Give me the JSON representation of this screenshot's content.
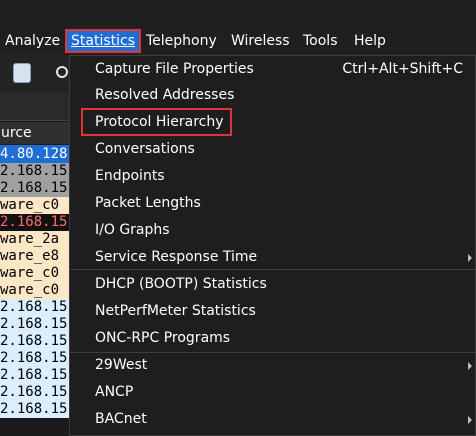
{
  "menubar": {
    "items": [
      "Analyze",
      "Statistics",
      "Telephony",
      "Wireless",
      "Tools",
      "Help"
    ]
  },
  "packet_list": {
    "column_header": "urce",
    "rows": [
      {
        "text": "4.80.128",
        "bg": "#1f6ed6",
        "fg": "#ffffff"
      },
      {
        "text": "2.168.15",
        "bg": "#a0a0a0",
        "fg": "#000000"
      },
      {
        "text": "2.168.15",
        "bg": "#a0a0a0",
        "fg": "#000000"
      },
      {
        "text": "ware_c0",
        "bg": "#fbe6c6",
        "fg": "#000000"
      },
      {
        "text": "2.168.15",
        "bg": "#121212",
        "fg": "#ff6b6b"
      },
      {
        "text": "ware_2a",
        "bg": "#fbe6c6",
        "fg": "#000000"
      },
      {
        "text": "ware_e8",
        "bg": "#fbe6c6",
        "fg": "#000000"
      },
      {
        "text": "ware_c0",
        "bg": "#fbe6c6",
        "fg": "#000000"
      },
      {
        "text": "ware_c0",
        "bg": "#fbe6c6",
        "fg": "#000000"
      },
      {
        "text": "2.168.15",
        "bg": "#dbeeff",
        "fg": "#000000"
      },
      {
        "text": "2.168.15",
        "bg": "#dbeeff",
        "fg": "#000000"
      },
      {
        "text": "2.168.15",
        "bg": "#dbeeff",
        "fg": "#000000"
      },
      {
        "text": "2.168.15",
        "bg": "#dbeeff",
        "fg": "#000000"
      },
      {
        "text": "2.168.15",
        "bg": "#dbeeff",
        "fg": "#000000"
      },
      {
        "text": "2.168.15",
        "bg": "#dbeeff",
        "fg": "#000000"
      },
      {
        "text": "2.168.15",
        "bg": "#dbeeff",
        "fg": "#000000"
      }
    ]
  },
  "statistics_menu": {
    "items": [
      {
        "label": "Capture File Properties",
        "shortcut": "Ctrl+Alt+Shift+C",
        "submenu": false
      },
      {
        "label": "Resolved Addresses",
        "shortcut": "",
        "submenu": false
      },
      {
        "label": "Protocol Hierarchy",
        "shortcut": "",
        "submenu": false,
        "highlighted": true
      },
      {
        "label": "Conversations",
        "shortcut": "",
        "submenu": false
      },
      {
        "label": "Endpoints",
        "shortcut": "",
        "submenu": false
      },
      {
        "label": "Packet Lengths",
        "shortcut": "",
        "submenu": false
      },
      {
        "label": "I/O Graphs",
        "shortcut": "",
        "submenu": false
      },
      {
        "label": "Service Response Time",
        "shortcut": "",
        "submenu": true
      },
      {
        "label": "DHCP (BOOTP) Statistics",
        "shortcut": "",
        "submenu": false
      },
      {
        "label": "NetPerfMeter Statistics",
        "shortcut": "",
        "submenu": false
      },
      {
        "label": "ONC-RPC Programs",
        "shortcut": "",
        "submenu": false
      },
      {
        "label": "29West",
        "shortcut": "",
        "submenu": true
      },
      {
        "label": "ANCP",
        "shortcut": "",
        "submenu": false
      },
      {
        "label": "BACnet",
        "shortcut": "",
        "submenu": true
      }
    ]
  },
  "colors": {
    "accent": "#1f6ed6",
    "annotation": "#e03535"
  }
}
